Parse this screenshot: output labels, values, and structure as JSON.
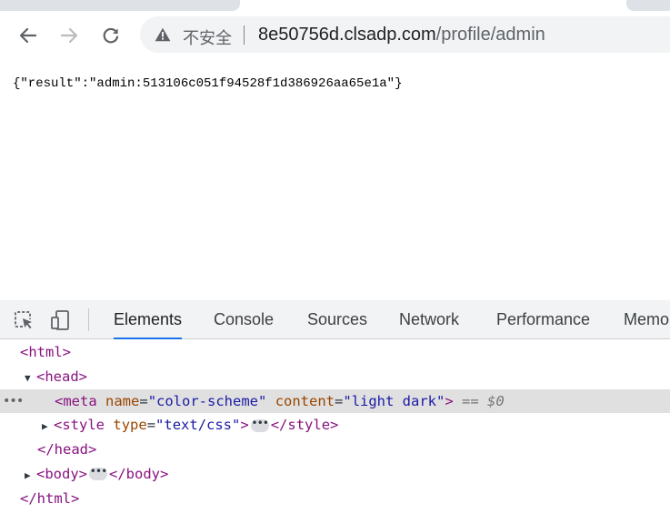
{
  "browser": {
    "security_label": "不安全",
    "url_host": "8e50756d.clsadp.com",
    "url_path": "/profile/admin"
  },
  "page": {
    "body_text": "{\"result\":\"admin:513106c051f94528f1d386926aa65e1a\"}"
  },
  "devtools": {
    "tabs": [
      "Elements",
      "Console",
      "Sources",
      "Network",
      "Performance",
      "Memo"
    ],
    "active_tab": "Elements",
    "dom": {
      "html_open": "<html>",
      "head_open": "<head>",
      "meta_tag": "meta",
      "meta_name_attr": "name",
      "meta_name_val": "\"color-scheme\"",
      "meta_content_attr": "content",
      "meta_content_val": "\"light dark\"",
      "selected_marker": "== $0",
      "style_open_tag": "style",
      "style_type_attr": "type",
      "style_type_val": "\"text/css\"",
      "style_close": "</style>",
      "head_close": "</head>",
      "body_open": "<body>",
      "body_close": "</body>",
      "html_close": "</html>"
    }
  },
  "colors": {
    "accent": "#1a73e8",
    "tag": "#881280",
    "attr_name": "#994500",
    "attr_value": "#1a1aa6"
  }
}
